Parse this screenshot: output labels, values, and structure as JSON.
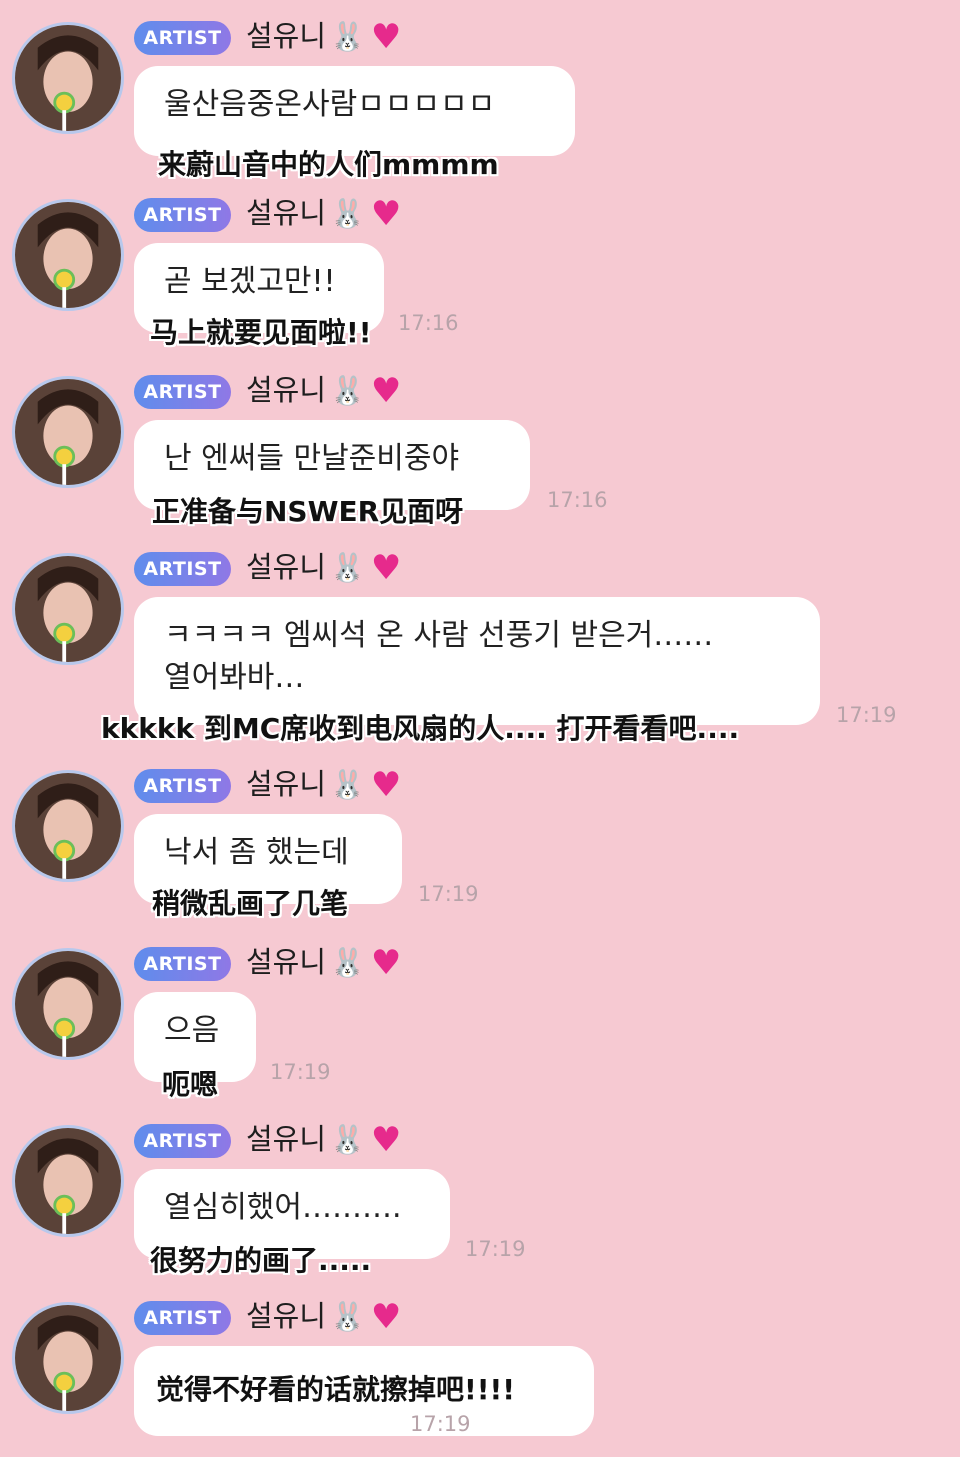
{
  "sender": {
    "badge": "ARTIST",
    "name": "설유니",
    "emoji": "🐰",
    "heart": "♥"
  },
  "colors": {
    "background": "#f6c9d2",
    "bubble": "#ffffff",
    "badge_gradient_start": "#5f8dec",
    "badge_gradient_end": "#8f78e6",
    "timestamp": "#b7a3a9",
    "heart": "#e62a8c"
  },
  "messages": [
    {
      "korean": [
        "울산음중온사람ㅁㅁㅁㅁㅁ"
      ],
      "chinese": "来蔚山音中的人们mmmm",
      "time": ""
    },
    {
      "korean": [
        "곧 보겠고만!!"
      ],
      "chinese": "马上就要见面啦!!",
      "time": "17:16"
    },
    {
      "korean": [
        "난 엔써들 만날준비중야"
      ],
      "chinese": "正准备与NSWER见面呀",
      "time": "17:16"
    },
    {
      "korean": [
        "ㅋㅋㅋㅋ 엠씨석 온 사람 선풍기 받은거……",
        "열어봐바…"
      ],
      "chinese": "kkkkk 到MC席收到电风扇的人.... 打开看看吧....",
      "time": "17:19"
    },
    {
      "korean": [
        "낙서 좀 했는데"
      ],
      "chinese": "稍微乱画了几笔",
      "time": "17:19"
    },
    {
      "korean": [
        "으음"
      ],
      "chinese": "呃嗯",
      "time": "17:19"
    },
    {
      "korean": [
        "열심히했어………."
      ],
      "chinese": "很努力的画了.....",
      "time": "17:19"
    },
    {
      "korean": [],
      "chinese": "觉得不好看的话就擦掉吧!!!!",
      "time": "17:19"
    }
  ]
}
